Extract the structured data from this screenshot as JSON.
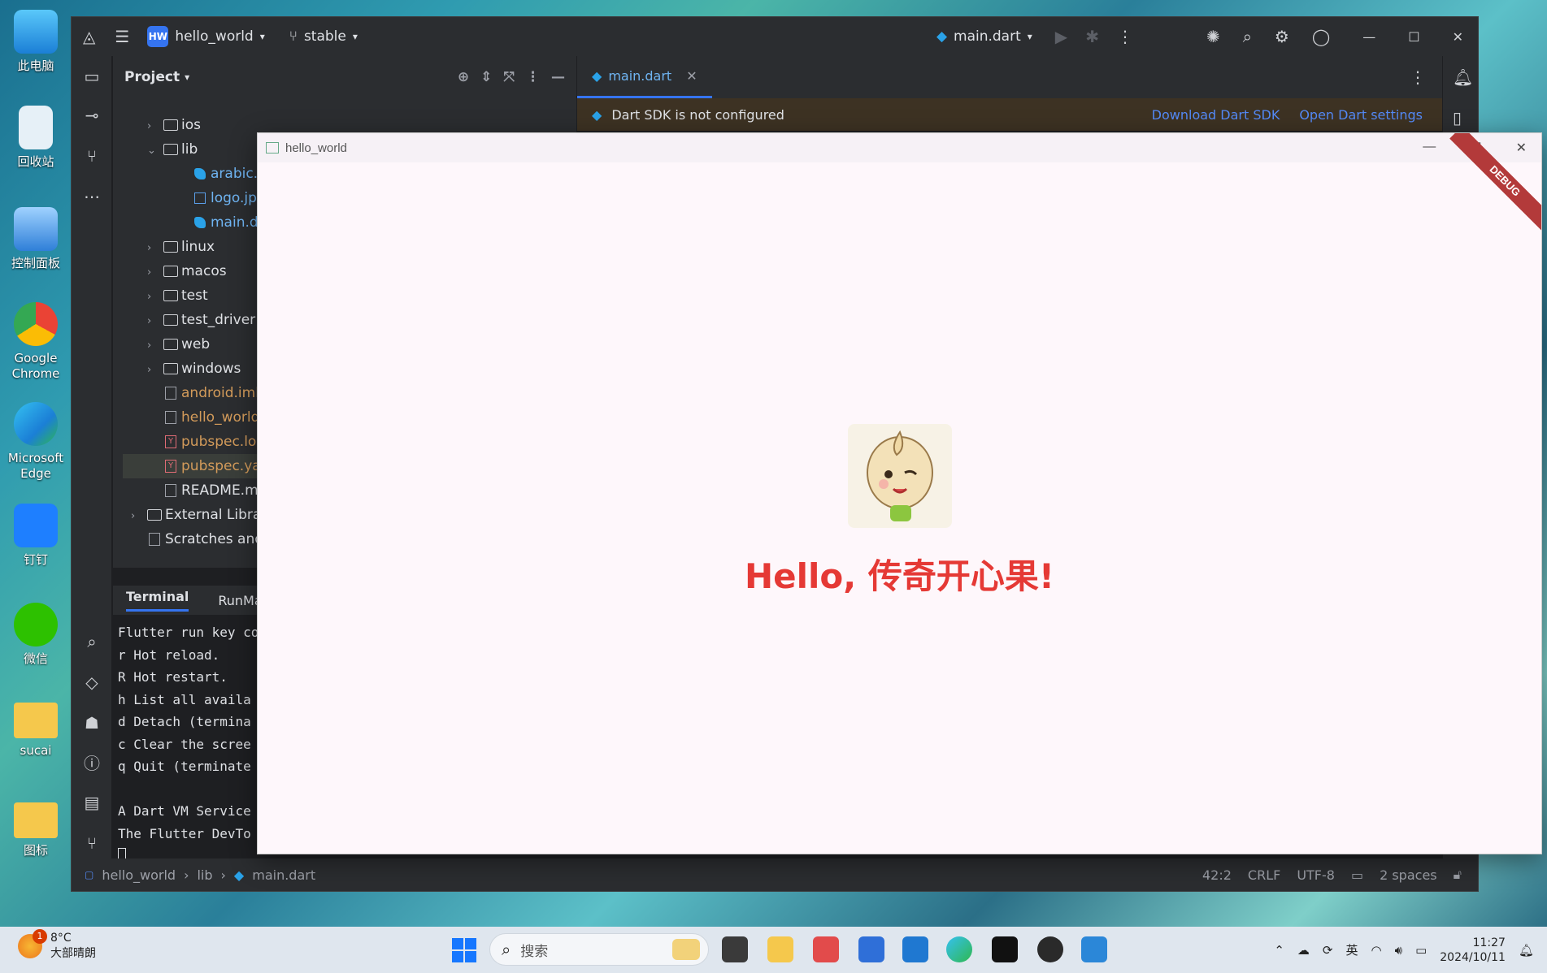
{
  "desktop": {
    "icons": [
      {
        "label": "此电脑",
        "color": "#2aa0e8",
        "icon": "computer-icon"
      },
      {
        "label": "回收站",
        "color": "#e6f0f7",
        "icon": "recycle-bin-icon"
      },
      {
        "label": "控制面板",
        "color": "#3a8ee6",
        "icon": "control-panel-icon"
      },
      {
        "label": "Google Chrome",
        "color": "#4285f4",
        "icon": "chrome-icon"
      },
      {
        "label": "Microsoft Edge",
        "color": "#1b9de2",
        "icon": "edge-icon"
      },
      {
        "label": "钉钉",
        "color": "#1e7fff",
        "icon": "dingtalk-icon"
      },
      {
        "label": "微信",
        "color": "#2dc100",
        "icon": "wechat-icon"
      },
      {
        "label": "sucai",
        "color": "#f5c84c",
        "icon": "folder-icon"
      },
      {
        "label": "图标",
        "color": "#f5c84c",
        "icon": "folder-icon"
      }
    ]
  },
  "ide": {
    "project_badge": "HW",
    "project_name": "hello_world",
    "branch": "stable",
    "run_config": "main.dart",
    "panel_title": "Project",
    "tree": [
      {
        "label": "ios",
        "type": "folder",
        "depth": 1,
        "expanded": false
      },
      {
        "label": "lib",
        "type": "folder",
        "depth": 1,
        "expanded": true
      },
      {
        "label": "arabic.da",
        "type": "dart",
        "depth": 2
      },
      {
        "label": "logo.jpg",
        "type": "img",
        "depth": 2
      },
      {
        "label": "main.dar",
        "type": "dart",
        "depth": 2
      },
      {
        "label": "linux",
        "type": "folder",
        "depth": 1,
        "expanded": false
      },
      {
        "label": "macos",
        "type": "folder",
        "depth": 1,
        "expanded": false
      },
      {
        "label": "test",
        "type": "folder",
        "depth": 1,
        "expanded": false
      },
      {
        "label": "test_driver",
        "type": "folder",
        "depth": 1,
        "expanded": false
      },
      {
        "label": "web",
        "type": "folder",
        "depth": 1,
        "expanded": false
      },
      {
        "label": "windows",
        "type": "folder",
        "depth": 1,
        "expanded": false
      },
      {
        "label": "android.iml",
        "type": "gen",
        "depth": 1
      },
      {
        "label": "hello_world.",
        "type": "gen",
        "depth": 1
      },
      {
        "label": "pubspec.loc",
        "type": "yaml",
        "depth": 1
      },
      {
        "label": "pubspec.yan",
        "type": "yaml",
        "depth": 1,
        "selected": true
      },
      {
        "label": "README.mc",
        "type": "md",
        "depth": 1
      },
      {
        "label": "External Librarie",
        "type": "lib",
        "depth": 0
      },
      {
        "label": "Scratches and C",
        "type": "scratch",
        "depth": 0
      }
    ],
    "editor_tab": "main.dart",
    "banner_text": "Dart SDK is not configured",
    "banner_link1": "Download Dart SDK",
    "banner_link2": "Open Dart settings",
    "terminal_tabs": [
      "Terminal",
      "RunMark"
    ],
    "terminal_lines": [
      "Flutter run key co",
      "r Hot reload.",
      "R Hot restart.",
      "h List all availa",
      "d Detach (termina",
      "c Clear the scree",
      "q Quit (terminate",
      "",
      "A Dart VM Service",
      "The Flutter DevTo"
    ],
    "status": {
      "crumb1": "hello_world",
      "crumb2": "lib",
      "crumb3": "main.dart",
      "position": "42:2",
      "line_sep": "CRLF",
      "encoding": "UTF-8",
      "indent": "2 spaces"
    }
  },
  "app": {
    "title": "hello_world",
    "debug_ribbon": "DEBUG",
    "hello_text": "Hello, 传奇开心果!"
  },
  "taskbar": {
    "weather_badge": "1",
    "temperature": "8°C",
    "weather_desc": "大部晴朗",
    "search_placeholder": "搜索",
    "lang": "英",
    "time": "11:27",
    "date": "2024/10/11"
  }
}
